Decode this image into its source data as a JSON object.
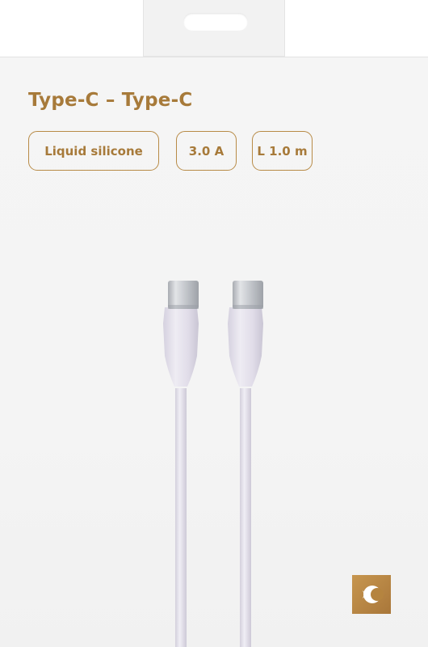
{
  "package": {
    "title": "Type-C – Type-C",
    "badges": [
      {
        "label": "Liquid silicone"
      },
      {
        "label": "3.0 A"
      },
      {
        "label": "L 1.0 m"
      }
    ]
  },
  "colors": {
    "accent_gold": "#a77a3a",
    "badge_border": "#b88b47",
    "box_background": "#f4f4f4",
    "cable_color": "#e4e1ec",
    "connector_metal": "#bfc2c6"
  },
  "icons": {
    "brand_logo": "brand-logo-icon"
  }
}
